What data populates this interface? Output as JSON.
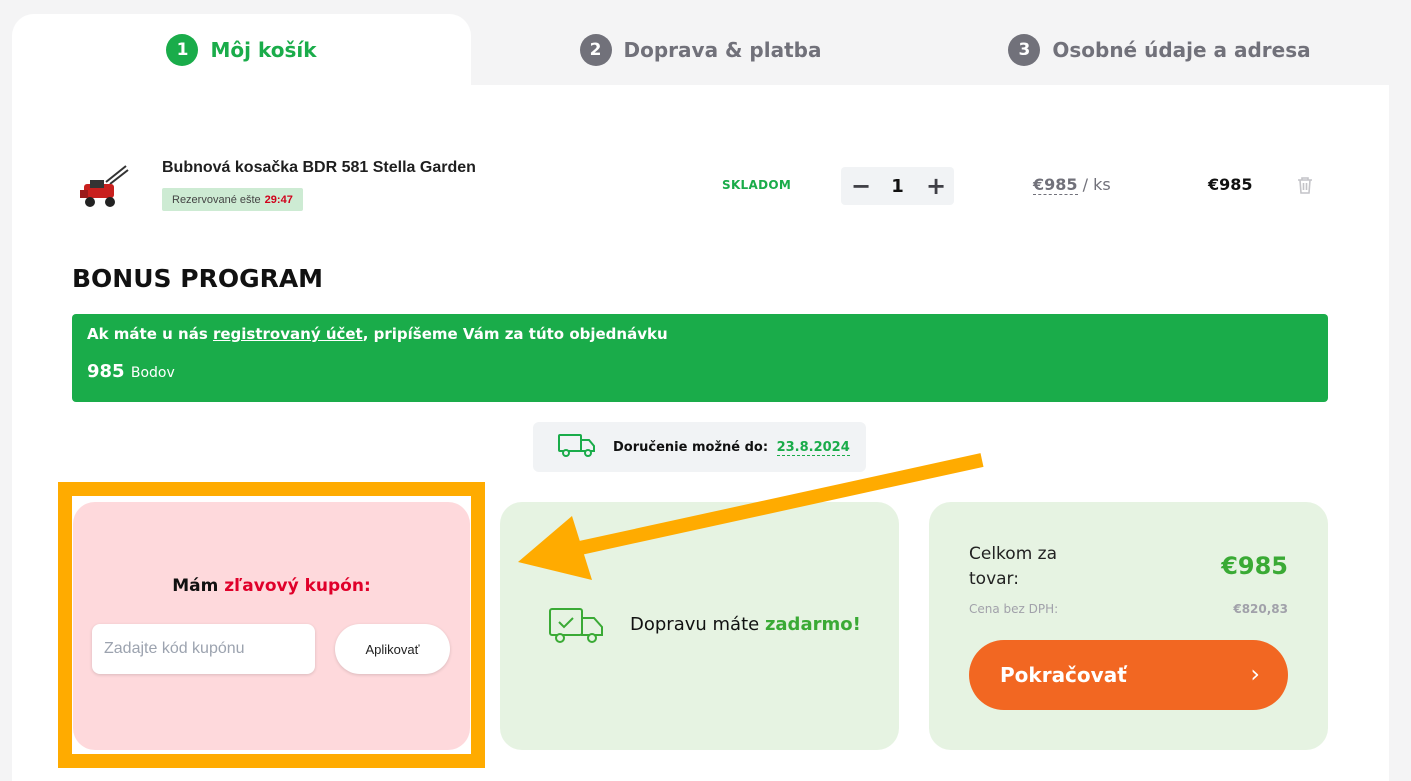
{
  "steps": [
    {
      "num": "1",
      "label": "Môj košík"
    },
    {
      "num": "2",
      "label": "Doprava & platba"
    },
    {
      "num": "3",
      "label": "Osobné údaje a adresa"
    }
  ],
  "item": {
    "name": "Bubnová kosačka BDR 581 Stella Garden",
    "reserved_label": "Rezervované ešte",
    "reserved_time": "29:47",
    "stock": "SKLADOM",
    "qty_minus": "−",
    "qty": "1",
    "qty_plus": "+",
    "unit_price": "€985",
    "unit_suffix": "/ ks",
    "total": "€985"
  },
  "bonus": {
    "title": "BONUS PROGRAM",
    "text_before": "Ak máte u nás ",
    "link": "registrovaný účet",
    "text_after": ", pripíšeme Vám za túto objednávku",
    "points": "985",
    "points_unit": "Bodov"
  },
  "delivery": {
    "label": "Doručenie možné do:",
    "date": "23.8.2024"
  },
  "coupon": {
    "title_start": "Mám ",
    "title_red": "zľavový kupón:",
    "placeholder": "Zadajte kód kupónu",
    "apply": "Aplikovať"
  },
  "shipping": {
    "text": "Dopravu máte ",
    "free": "zadarmo!"
  },
  "summary": {
    "label": "Celkom za tovar:",
    "amount": "€985",
    "novat_label": "Cena bez DPH:",
    "novat_amount": "€820,83",
    "continue": "Pokračovať",
    "chevron": "›"
  },
  "colors": {
    "green": "#1aac4a",
    "orange": "#f26722",
    "highlight": "#ffab00",
    "coupon_bg": "#fed9dc",
    "card_bg": "#e6f3e2"
  }
}
